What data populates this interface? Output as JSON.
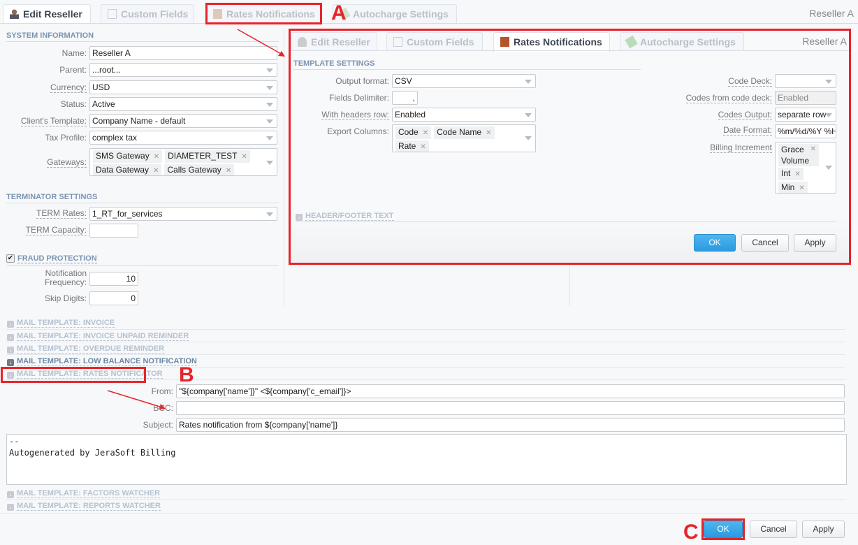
{
  "tabs": [
    {
      "label": "Edit Reseller",
      "icon": "user-icon",
      "active": true
    },
    {
      "label": "Custom Fields",
      "icon": "list-icon"
    },
    {
      "label": "Rates Notifications",
      "icon": "notebook-icon"
    },
    {
      "label": "Autocharge Settings",
      "icon": "money-icon"
    }
  ],
  "entity_name": "Reseller A",
  "system_info": {
    "title": "SYSTEM INFORMATION",
    "name": {
      "label": "Name:",
      "value": "Reseller A"
    },
    "parent": {
      "label": "Parent:",
      "value": "...root..."
    },
    "currency": {
      "label": "Currency:",
      "value": "USD"
    },
    "status": {
      "label": "Status:",
      "value": "Active"
    },
    "client_template": {
      "label": "Client's Template:",
      "value": "Company Name - default"
    },
    "tax_profile": {
      "label": "Tax Profile:",
      "value": "complex tax"
    },
    "gateways": {
      "label": "Gateways:",
      "values": [
        "SMS Gateway",
        "DIAMETER_TEST",
        "Data Gateway",
        "Calls Gateway"
      ]
    }
  },
  "terminator": {
    "title": "TERMINATOR SETTINGS",
    "term_rates": {
      "label": "TERM Rates:",
      "value": "1_RT_for_services"
    },
    "term_capacity": {
      "label": "TERM Capacity:",
      "value": ""
    }
  },
  "fraud": {
    "title": "FRAUD PROTECTION",
    "checked": true,
    "notification_frequency": {
      "label1": "Notification",
      "label2": "Frequency:",
      "value": "10"
    },
    "skip_digits": {
      "label": "Skip Digits:",
      "value": "0"
    }
  },
  "popup": {
    "tabs": [
      {
        "label": "Edit Reseller"
      },
      {
        "label": "Custom Fields"
      },
      {
        "label": "Rates Notifications",
        "active": true
      },
      {
        "label": "Autocharge Settings"
      }
    ],
    "entity_name": "Reseller A",
    "section": "TEMPLATE SETTINGS",
    "output_format": {
      "label": "Output format:",
      "value": "CSV"
    },
    "fields_delimiter": {
      "label": "Fields Delimiter:",
      "value": ","
    },
    "headers_row": {
      "label": "With headers row:",
      "value": "Enabled"
    },
    "export_columns": {
      "label": "Export Columns:",
      "values": [
        "Code",
        "Code Name",
        "Rate"
      ]
    },
    "code_deck": {
      "label": "Code Deck:",
      "value": ""
    },
    "codes_from_deck": {
      "label": "Codes from code deck:",
      "value": "Enabled"
    },
    "codes_output": {
      "label": "Codes Output:",
      "value": "separate row"
    },
    "date_format": {
      "label": "Date Format:",
      "value": "%m/%d/%Y %H"
    },
    "billing_increment": {
      "label": "Billing Increment",
      "values": [
        "Grace",
        "Volume",
        "Int",
        "Min"
      ]
    },
    "header_footer": "HEADER/FOOTER TEXT",
    "ok": "OK",
    "cancel": "Cancel",
    "apply": "Apply"
  },
  "mail_templates": [
    "MAIL TEMPLATE: INVOICE",
    "MAIL TEMPLATE: INVOICE UNPAID REMINDER",
    "MAIL TEMPLATE: OVERDUE REMINDER",
    "MAIL TEMPLATE: LOW BALANCE NOTIFICATION",
    "MAIL TEMPLATE: RATES NOTIFICATOR"
  ],
  "mail_after": [
    "MAIL TEMPLATE: FACTORS WATCHER",
    "MAIL TEMPLATE: REPORTS WATCHER"
  ],
  "rates_mail": {
    "from": {
      "label": "From:",
      "value": "\"${company['name']}\" <${company['c_email']}>"
    },
    "bcc": {
      "label": "BCC:",
      "value": ""
    },
    "subject": {
      "label": "Subject:",
      "value": "Rates notification from ${company['name']}"
    },
    "body_line1": "--",
    "body_line2": "Autogenerated by JeraSoft Billing"
  },
  "buttons": {
    "ok": "OK",
    "cancel": "Cancel",
    "apply": "Apply"
  },
  "annotations": {
    "a": "A",
    "b": "B",
    "c": "C"
  },
  "colors": {
    "accent": "#2a9ae0",
    "highlight": "#e8232a",
    "section": "#7b94b0"
  }
}
